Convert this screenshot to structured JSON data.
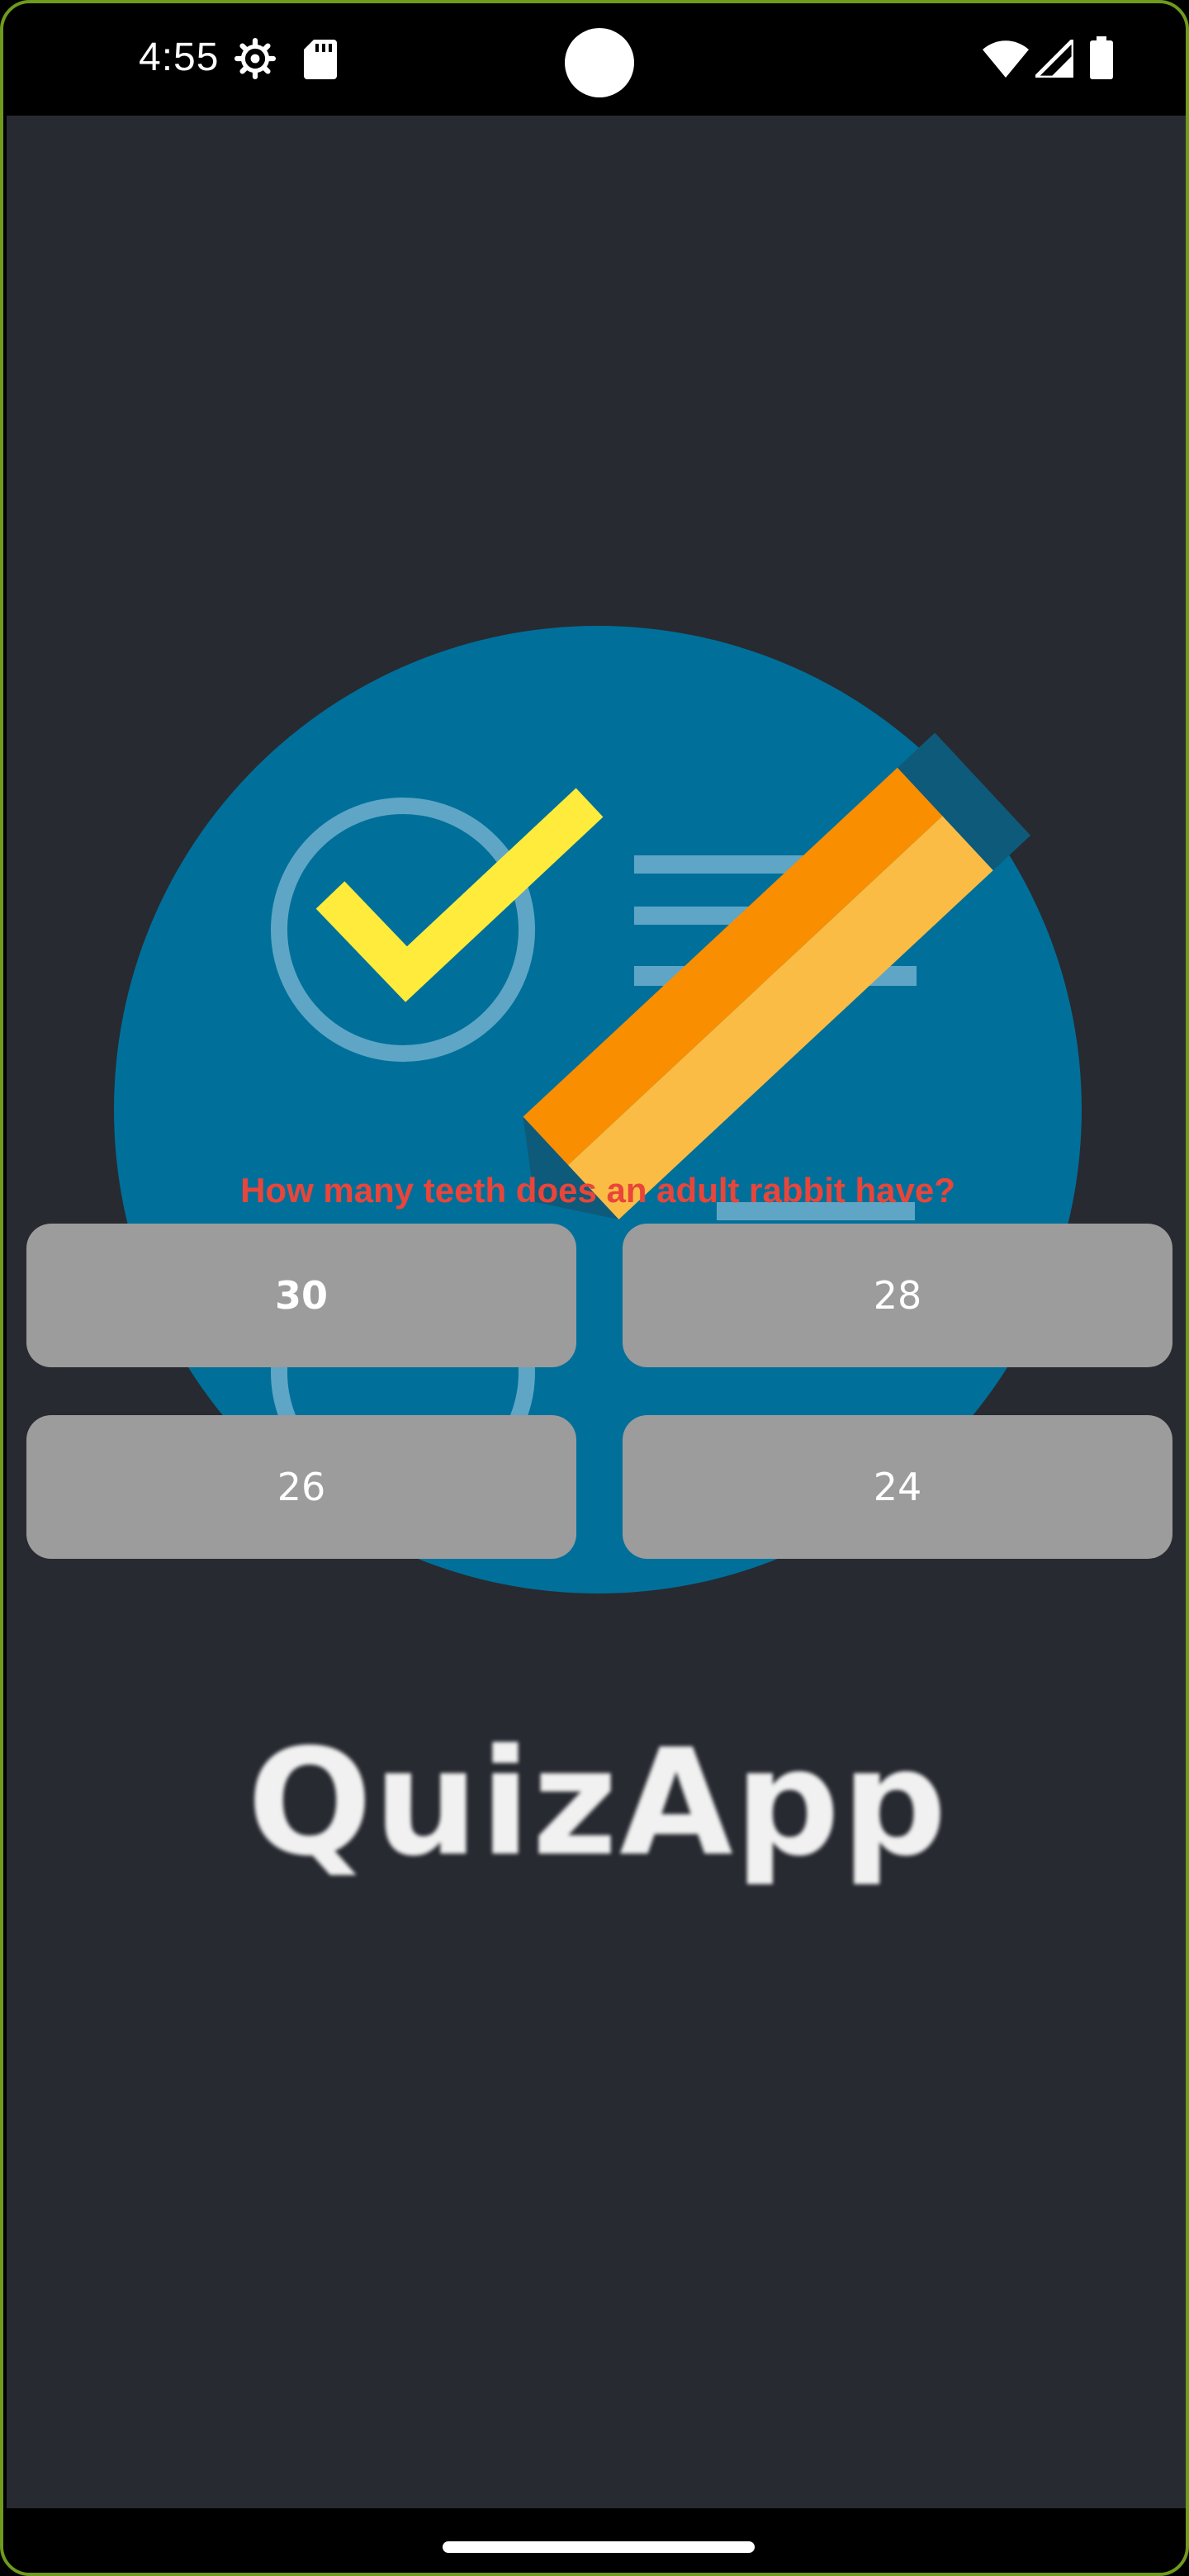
{
  "status_bar": {
    "time": "4:55",
    "icons": [
      "settings-gear-icon",
      "sd-card-icon",
      "wifi-icon",
      "cell-signal-icon",
      "battery-icon"
    ]
  },
  "quiz": {
    "question": "How many teeth does an adult rabbit have?",
    "answers": [
      "30",
      "28",
      "26",
      "24"
    ]
  },
  "splash": {
    "brand_text": "QuizApp",
    "colors": {
      "background": "#272a31",
      "circle": "#00709a",
      "check": "#ffeb3b",
      "pencil_light": "#fbbc45",
      "pencil_dark": "#f98e00",
      "line": "#5fa6c6"
    }
  },
  "theme": {
    "question_color": "#e9453a",
    "button_color": "#9c9c9c",
    "frame_border": "#6f9a1c"
  }
}
